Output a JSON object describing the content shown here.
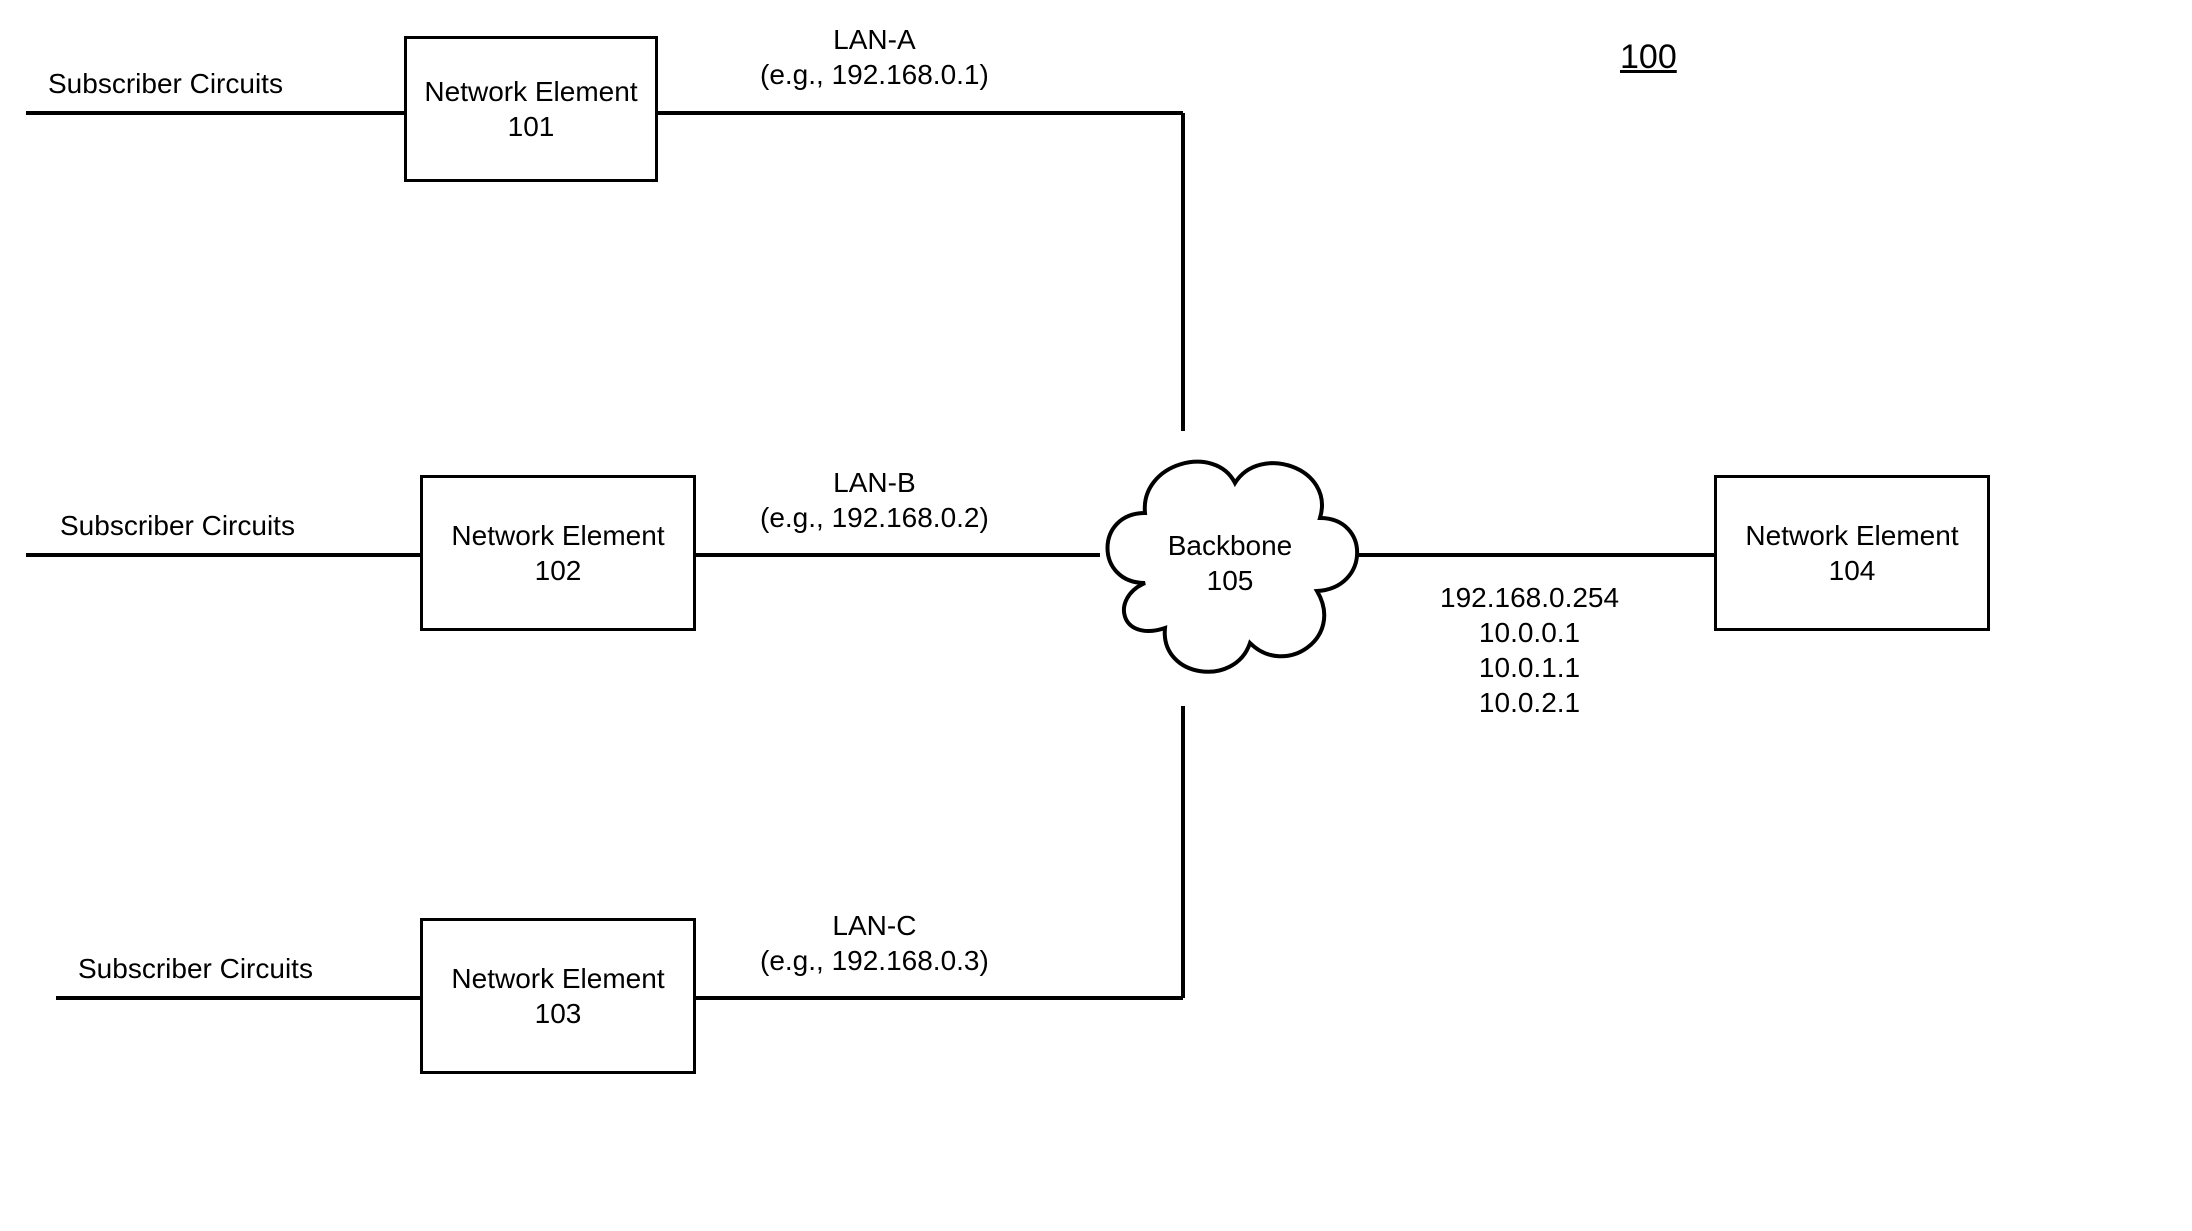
{
  "figure_number": "100",
  "subscriber_label_1": "Subscriber Circuits",
  "subscriber_label_2": "Subscriber Circuits",
  "subscriber_label_3": "Subscriber Circuits",
  "ne101": {
    "title": "Network Element",
    "id": "101"
  },
  "ne102": {
    "title": "Network Element",
    "id": "102"
  },
  "ne103": {
    "title": "Network Element",
    "id": "103"
  },
  "ne104": {
    "title": "Network Element",
    "id": "104"
  },
  "lan_a": {
    "name": "LAN-A",
    "addr": "(e.g., 192.168.0.1)"
  },
  "lan_b": {
    "name": "LAN-B",
    "addr": "(e.g., 192.168.0.2)"
  },
  "lan_c": {
    "name": "LAN-C",
    "addr": "(e.g., 192.168.0.3)"
  },
  "backbone": {
    "title": "Backbone",
    "id": "105"
  },
  "ne104_ips": {
    "ip1": "192.168.0.254",
    "ip2": "10.0.0.1",
    "ip3": "10.0.1.1",
    "ip4": "10.0.2.1"
  }
}
